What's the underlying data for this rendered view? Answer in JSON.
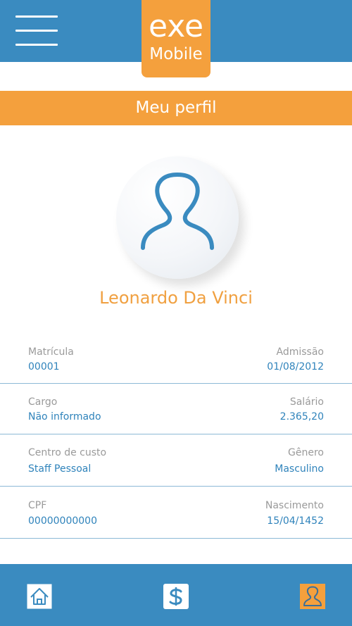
{
  "header": {
    "logo_line1": "exe",
    "logo_line2": "Mobile",
    "menu_icon": "hamburger-menu-icon"
  },
  "page": {
    "title": "Meu perfil"
  },
  "profile": {
    "avatar_icon": "user-silhouette-icon",
    "name": "Leonardo Da Vinci"
  },
  "fields": [
    {
      "left_label": "Matrícula",
      "left_value": "00001",
      "right_label": "Admissão",
      "right_value": "01/08/2012"
    },
    {
      "left_label": "Cargo",
      "left_value": "Não informado",
      "right_label": "Salário",
      "right_value": "2.365,20"
    },
    {
      "left_label": "Centro de custo",
      "left_value": "Staff Pessoal",
      "right_label": "Gênero",
      "right_value": "Masculino"
    },
    {
      "left_label": "CPF",
      "left_value": "00000000000",
      "right_label": "Nascimento",
      "right_value": "15/04/1452"
    }
  ],
  "bottom_nav": {
    "items": [
      {
        "icon": "home-icon",
        "active": false
      },
      {
        "icon": "dollar-icon",
        "active": false
      },
      {
        "icon": "profile-icon",
        "active": true
      }
    ]
  },
  "colors": {
    "primary_blue": "#3a8bc0",
    "accent_orange": "#f4a03d",
    "value_blue": "#2f83bb",
    "label_gray": "#9a9a9a"
  }
}
